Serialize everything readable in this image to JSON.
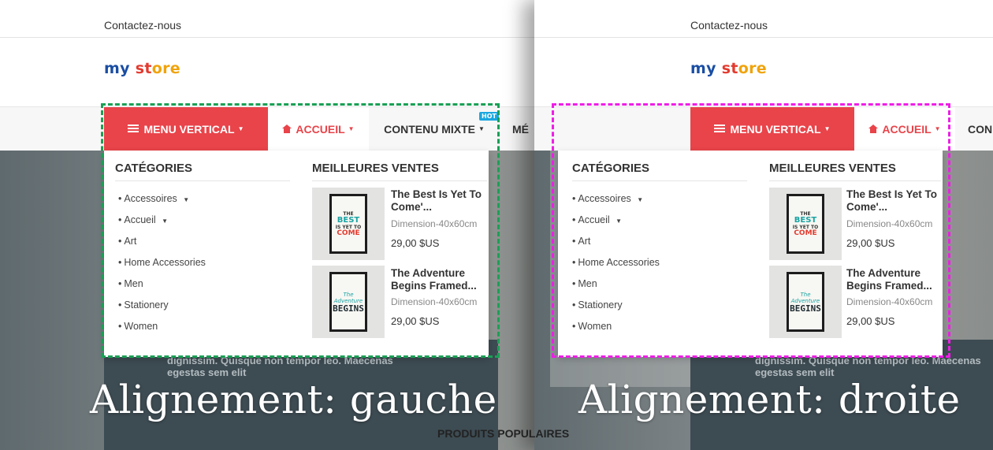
{
  "left": {
    "contact": "Contactez-nous",
    "logo": [
      "my",
      " ",
      "st",
      "ore"
    ],
    "tabs": {
      "vertical_menu": "MENU VERTICAL",
      "home": "ACCUEIL",
      "mixed": "CONTENU MIXTE",
      "next_partial": "MÉ"
    },
    "hot_badge": "HOT",
    "categories_title": "CATÉGORIES",
    "categories": [
      "Accessoires",
      "Accueil",
      "Art",
      "Home Accessories",
      "Men",
      "Stationery",
      "Women"
    ],
    "bestsellers_title": "MEILLEURES VENTES",
    "products": [
      {
        "name": "The Best Is Yet To Come'...",
        "dimension": "Dimension-40x60cm",
        "price": "29,00 $US"
      },
      {
        "name": "The Adventure Begins Framed...",
        "dimension": "Dimension-40x60cm",
        "price": "29,00 $US"
      }
    ],
    "hero_text": [
      "dignissim. Quisque non tempor leo. Maecenas",
      "egestas sem elit"
    ],
    "caption": "Alignement: gauche"
  },
  "right": {
    "contact": "Contactez-nous",
    "tabs": {
      "vertical_menu": "MENU VERTICAL",
      "home": "ACCUEIL",
      "next_partial": "CON"
    },
    "categories_title": "CATÉGORIES",
    "categories": [
      "Accessoires",
      "Accueil",
      "Art",
      "Home Accessories",
      "Men",
      "Stationery",
      "Women"
    ],
    "bestsellers_title": "MEILLEURES VENTES",
    "products": [
      {
        "name": "The Best Is Yet To Come'...",
        "dimension": "Dimension-40x60cm",
        "price": "29,00 $US"
      },
      {
        "name": "The Adventure Begins Framed...",
        "dimension": "Dimension-40x60cm",
        "price": "29,00 $US"
      }
    ],
    "hero_text": [
      "dignissim. Quisque non tempor leo. Maecenas",
      "egestas sem elit"
    ],
    "caption": "Alignement: droite"
  },
  "popular_products": "PRODUITS POPULAIRES",
  "poster1": [
    "THE",
    "BEST",
    "IS YET TO",
    "COME"
  ],
  "poster2": [
    "The",
    "Adventure",
    "BEGINS"
  ],
  "colors": {
    "accent_red": "#e8444a",
    "guide_green": "#1aa055",
    "guide_magenta": "#ee1ee6",
    "hot_blue": "#1aa7e0"
  }
}
